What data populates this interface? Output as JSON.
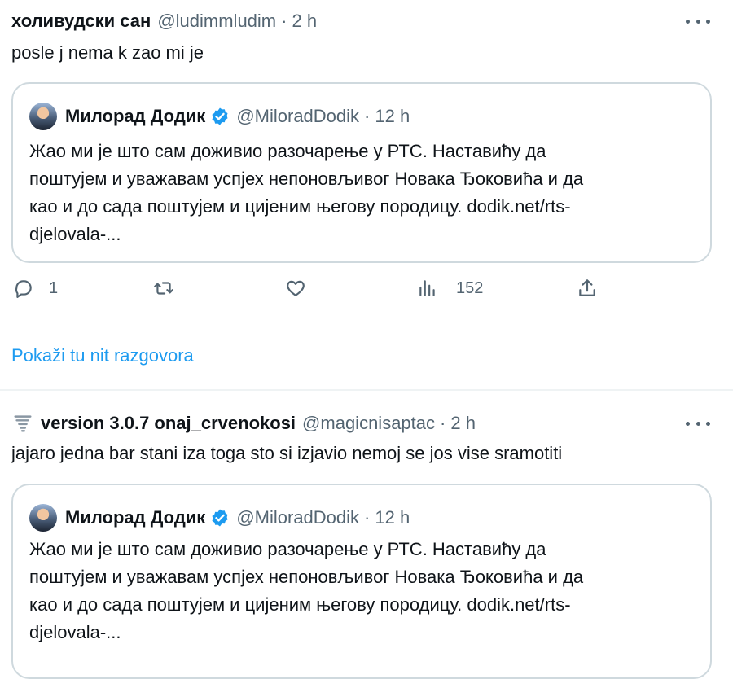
{
  "tweet1": {
    "name": "холивудски сан",
    "handle": "@ludimmludim",
    "sep": "·",
    "time": "2 h",
    "text": "posle j nema k zao mi je",
    "quote": {
      "name": "Милорад Додик",
      "handle": "@MiloradDodik",
      "sep": "·",
      "time": "12 h",
      "lines": [
        "Жао ми је што сам доживио разочарење у РТС. Наставићу да",
        "поштујем и уважавам успјех непоновљивог Новака Ђоковића и да",
        "као и до сада поштујем и цијеним његову породицу. dodik.net/rts-",
        "djelovala-..."
      ]
    },
    "actions": {
      "reply_count": "1",
      "views_count": "152"
    },
    "show_thread": "Pokaži tu nit razgovora"
  },
  "tweet2": {
    "name": "version 3.0.7 onaj_crvenokosi",
    "handle": "@magicnisaptac",
    "sep": "·",
    "time": "2 h",
    "text": "jajaro jedna bar stani iza toga sto si izjavio nemoj se jos vise sramotiti",
    "quote": {
      "name": "Милорад Додик",
      "handle": "@MiloradDodik",
      "sep": "·",
      "time": "12 h",
      "lines": [
        "Жао ми је што сам доживио разочарење у РТС. Наставићу да",
        "поштујем и уважавам успјех непоновљивог Новака Ђоковића и да",
        "као и до сада поштујем и цијеним његову породицу. dodik.net/rts-",
        "djelovala-..."
      ]
    }
  },
  "colors": {
    "accent": "#1d9bf0",
    "muted": "#536471",
    "border": "#cfd9de",
    "verified": "#1d9bf0"
  },
  "icons": {
    "reply": "reply-icon",
    "retweet": "retweet-icon",
    "like": "heart-icon",
    "views": "views-icon",
    "share": "share-icon",
    "more": "more-icon",
    "verified": "verified-badge-icon",
    "emoji": "tornado-emoji-icon"
  }
}
